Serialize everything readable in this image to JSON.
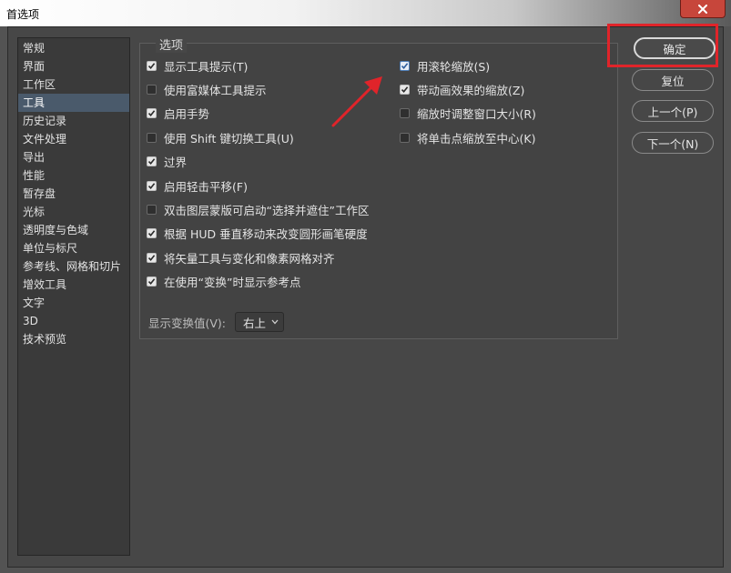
{
  "window": {
    "title": "首选项"
  },
  "sidebar": {
    "items": [
      {
        "label": "常规"
      },
      {
        "label": "界面"
      },
      {
        "label": "工作区"
      },
      {
        "label": "工具"
      },
      {
        "label": "历史记录"
      },
      {
        "label": "文件处理"
      },
      {
        "label": "导出"
      },
      {
        "label": "性能"
      },
      {
        "label": "暂存盘"
      },
      {
        "label": "光标"
      },
      {
        "label": "透明度与色域"
      },
      {
        "label": "单位与标尺"
      },
      {
        "label": "参考线、网格和切片"
      },
      {
        "label": "增效工具"
      },
      {
        "label": "文字"
      },
      {
        "label": "3D"
      },
      {
        "label": "技术预览"
      }
    ],
    "active_index": 3
  },
  "options": {
    "legend": "选项",
    "left": [
      {
        "label": "显示工具提示(T)",
        "checked": true
      },
      {
        "label": "使用富媒体工具提示",
        "checked": false
      },
      {
        "label": "启用手势",
        "checked": true
      },
      {
        "label": "使用 Shift 键切换工具(U)",
        "checked": false
      },
      {
        "label": "过界",
        "checked": true
      },
      {
        "label": "启用轻击平移(F)",
        "checked": true
      },
      {
        "label": "双击图层蒙版可启动“选择并遮住”工作区",
        "checked": false
      },
      {
        "label": "根据 HUD 垂直移动来改变圆形画笔硬度",
        "checked": true
      },
      {
        "label": "将矢量工具与变化和像素网格对齐",
        "checked": true
      },
      {
        "label": "在使用“变换”时显示参考点",
        "checked": true
      }
    ],
    "right": [
      {
        "label": "用滚轮缩放(S)",
        "checked": true,
        "focused": true
      },
      {
        "label": "带动画效果的缩放(Z)",
        "checked": true
      },
      {
        "label": "缩放时调整窗口大小(R)",
        "checked": false
      },
      {
        "label": "将单击点缩放至中心(K)",
        "checked": false
      }
    ],
    "transform_label": "显示变换值(V):",
    "transform_value": "右上"
  },
  "buttons": {
    "ok": "确定",
    "reset": "复位",
    "prev": "上一个(P)",
    "next": "下一个(N)"
  },
  "colors": {
    "highlight": "#e0242a",
    "active_item": "#4a5a6b"
  }
}
